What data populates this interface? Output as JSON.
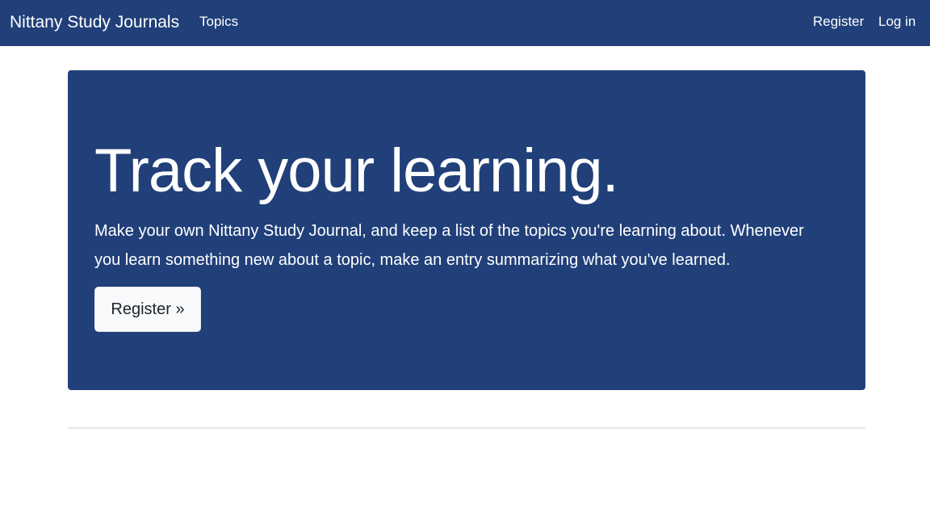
{
  "navbar": {
    "brand": "Nittany Study Journals",
    "links": {
      "topics": "Topics",
      "register": "Register",
      "login": "Log in"
    },
    "background_color": "#21407a"
  },
  "hero": {
    "title": "Track your learning.",
    "lead": "Make your own Nittany Study Journal, and keep a list of the topics you're learning about. Whenever you learn something new about a topic, make an entry summarizing what you've learned.",
    "button_label": "Register »",
    "background_color": "#21407a"
  }
}
